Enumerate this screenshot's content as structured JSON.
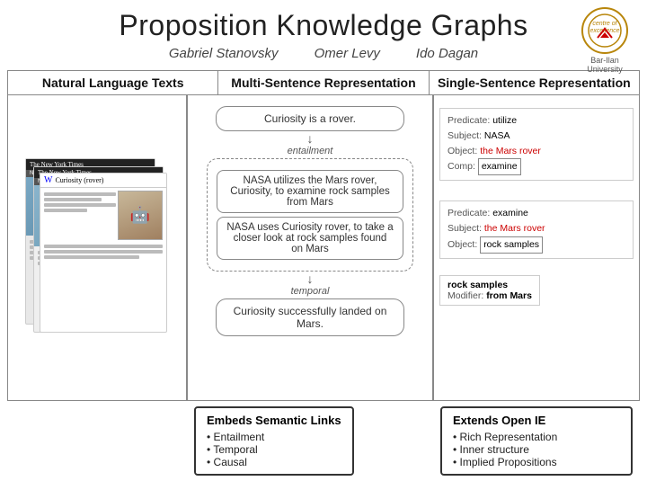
{
  "page": {
    "title": "Proposition Knowledge Graphs",
    "authors": [
      "Gabriel Stanovsky",
      "Omer Levy",
      "Ido Dagan"
    ],
    "institution": "Bar-Ilan University",
    "col_headers": [
      "Natural Language Texts",
      "Multi-Sentence Representation",
      "Single-Sentence Representation"
    ],
    "mid_flow": {
      "box1": "Curiosity is a rover.",
      "label1": "entailment",
      "dashed_box": {
        "inner1": "NASA utilizes the Mars rover, Curiosity, to examine rock samples from Mars",
        "inner2": "NASA uses Curiosity rover, to take a closer look at rock samples found on Mars"
      },
      "label2": "temporal",
      "box2": "Curiosity successfully landed on Mars."
    },
    "right_panel": {
      "pred1": {
        "predicate": "utilize",
        "subject": "NASA",
        "object": "the Mars rover",
        "comp": "examine"
      },
      "pred2": {
        "predicate": "examine",
        "subject": "the Mars rover",
        "object": "rock samples"
      },
      "bottom": {
        "text": "rock samples",
        "modifier_label": "Modifier:",
        "modifier_value": "from Mars"
      }
    },
    "bottom_left": {
      "title": "Embeds Semantic Links",
      "items": [
        "Entailment",
        "Temporal",
        "Causal"
      ]
    },
    "bottom_right": {
      "title": "Extends Open IE",
      "items": [
        "Rich Representation",
        "Inner structure",
        "Implied Propositions"
      ]
    }
  }
}
